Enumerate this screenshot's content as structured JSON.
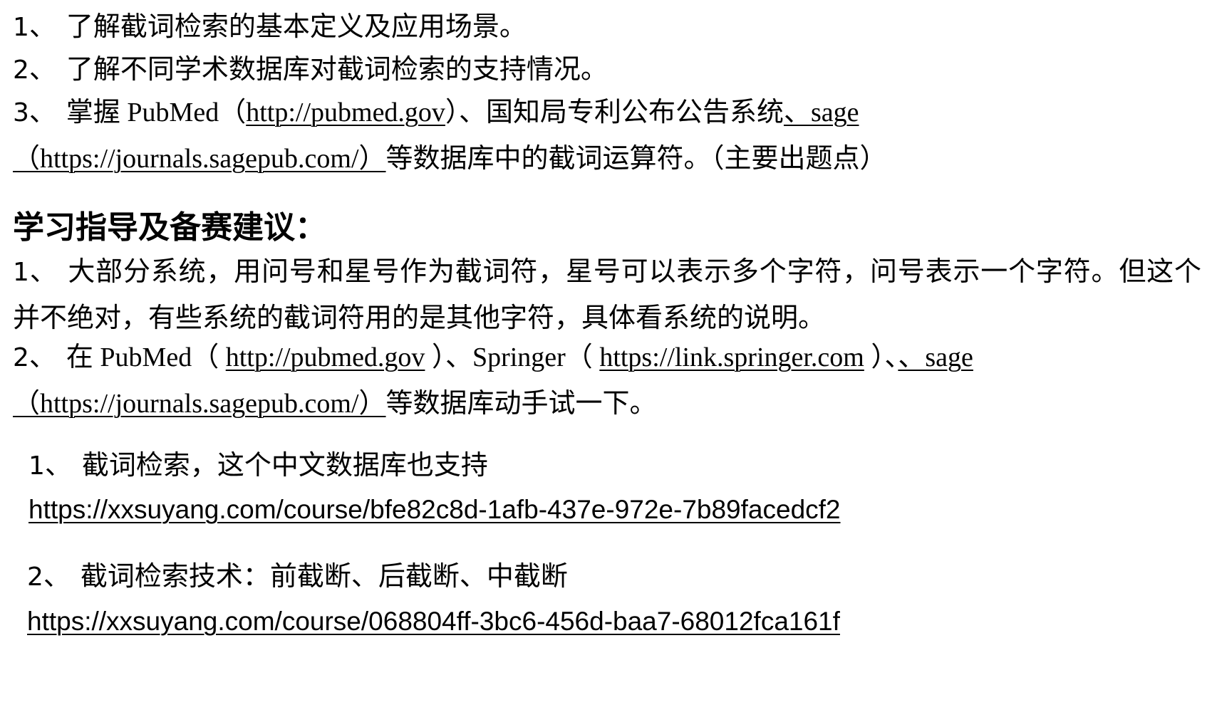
{
  "objectives": [
    {
      "num": "1",
      "sep": "、",
      "text": "了解截词检索的基本定义及应用场景。"
    },
    {
      "num": "2",
      "sep": "、",
      "text": "了解不同学术数据库对截词检索的支持情况。"
    },
    {
      "num": "3",
      "sep": "、",
      "text_a": "掌握 PubMed（",
      "link_pubmed": "http://pubmed.gov",
      "text_b": "）、国知局专利公布公告系统",
      "link_sage_a": "、sage",
      "link_sage_b": "（https://journals.sagepub.com/）",
      "text_c": "等数据库中的截词运算符。（主要出题点）"
    }
  ],
  "heading": "学习指导及备赛建议：",
  "advice": [
    {
      "num": "1",
      "sep": "、",
      "text": "大部分系统，用问号和星号作为截词符，星号可以表示多个字符，问号表示一个字符。但这个并不绝对，有些系统的截词符用的是其他字符，具体看系统的说明。"
    },
    {
      "num": "2",
      "sep": "、",
      "text_a": "在 PubMed（",
      "link_pubmed": "http://pubmed.gov",
      "text_b": "）、Springer（",
      "link_springer": "https://link.springer.com",
      "text_c": "）、",
      "link_sage_a": "、sage",
      "link_sage_b": "（https://journals.sagepub.com/）",
      "text_d": "等数据库动手试一下。"
    }
  ],
  "courses": [
    {
      "num": "1",
      "sep": "、",
      "title": "截词检索，这个中文数据库也支持",
      "url": "https://xxsuyang.com/course/bfe82c8d-1afb-437e-972e-7b89facedcf2"
    },
    {
      "num": "2",
      "sep": "、",
      "title": "截词检索技术：前截断、后截断、中截断",
      "url": "https://xxsuyang.com/course/068804ff-3bc6-456d-baa7-68012fca161f"
    }
  ]
}
